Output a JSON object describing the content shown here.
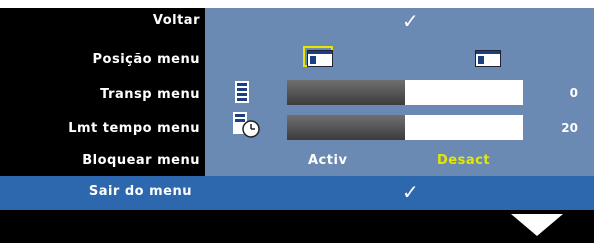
{
  "menu": {
    "back_label": "Voltar",
    "position_label": "Posição menu",
    "transp_label": "Transp menu",
    "timeout_label": "Lmt tempo menu",
    "lock_label": "Bloquear menu",
    "exit_label": "Sair do menu"
  },
  "values": {
    "transp": "0",
    "transp_fraction": 0.0,
    "timeout": "20",
    "timeout_fraction": 0.5
  },
  "lock": {
    "on_label": "Activ",
    "off_label": "Desact",
    "selected": "off"
  },
  "checkmark": "✓",
  "colors": {
    "panel": "#6a8ab3",
    "highlight": "#2d67ae",
    "selected_text": "#e6e600",
    "background": "#000000"
  },
  "icons": {
    "back": "check-icon",
    "position_left": "menu-position-left-icon",
    "position_right": "menu-position-right-icon",
    "transp": "transparency-icon",
    "timeout": "timer-icon",
    "exit": "check-icon",
    "nav": "down-arrow-icon"
  }
}
